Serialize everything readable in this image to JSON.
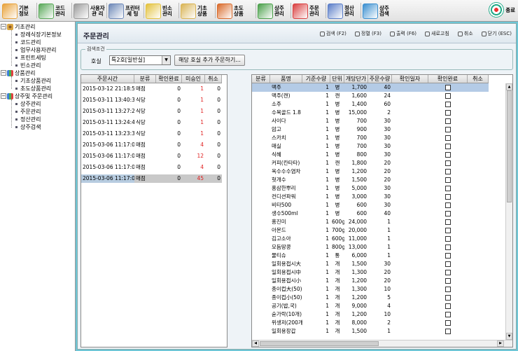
{
  "toolbar": {
    "items": [
      {
        "label": "기본\n정보",
        "icon": "pencils-icon",
        "color": "#e8a23a"
      },
      {
        "label": "코드\n관리",
        "icon": "colorful-grid-icon",
        "color": "#58a858"
      },
      {
        "label": "사용자\n관 리",
        "icon": "user-robot-icon",
        "color": "#9a9a9a"
      },
      {
        "label": "프린터\n세 팅",
        "icon": "printer-icon",
        "color": "#6d88b8"
      },
      {
        "label": "빈소\n관리",
        "icon": "folder-icon",
        "color": "#e3c23d"
      },
      {
        "label": "기초\n상품",
        "icon": "cube-icon",
        "color": "#d9b455"
      },
      {
        "label": "초도\n상품",
        "icon": "books-icon",
        "color": "#d96a2a"
      },
      {
        "label": "상주\n관리",
        "icon": "people-group-icon",
        "color": "#4aa04a"
      },
      {
        "label": "주문\n관리",
        "icon": "order-form-icon",
        "color": "#d94040"
      },
      {
        "label": "정산\n관리",
        "icon": "calculator-icon",
        "color": "#5a7dc8"
      },
      {
        "label": "상주\n검색",
        "icon": "magnifier-icon",
        "color": "#3a8fd0"
      }
    ],
    "exit_label": "종료",
    "exit_icon": "target-icon"
  },
  "tree": {
    "groups": [
      {
        "label": "기초관리",
        "icon": "gear-folder-icon",
        "expand": "⊟",
        "children": [
          "장례식장기본정보",
          "코드관리",
          "업무사용자관리",
          "프린트세팅",
          "빈소관리"
        ]
      },
      {
        "label": "상품관리",
        "icon": "bar-chart-icon",
        "expand": "⊟",
        "children": [
          "기초상품관리",
          "초도상품관리"
        ]
      },
      {
        "label": "상주및 주문관리",
        "icon": "bar-chart-icon",
        "expand": "⊟",
        "children": [
          "상주관리",
          "주문관리",
          "정산관리",
          "상주검색"
        ]
      }
    ]
  },
  "panel": {
    "title": "주문관리",
    "actions": [
      "검색 (F2)",
      "정렬 (F3)",
      "출력 (F6)",
      "새로고침",
      "취소",
      "닫기 (ESC)"
    ],
    "search_legend": "검색조건",
    "room_label": "호실",
    "room_value": "특2호[일반실]",
    "add_button": "해당 호실 추가 주문하기..."
  },
  "left_grid": {
    "columns": [
      "주문시간",
      "분류",
      "확인완료",
      "미승인",
      "취소"
    ],
    "rows": [
      [
        "2015-03-12 21:18:52",
        "매점",
        "0",
        "1",
        "0"
      ],
      [
        "2015-03-11 13:40:36",
        "식당",
        "0",
        "1",
        "0"
      ],
      [
        "2015-03-11 13:27:26",
        "식당",
        "0",
        "1",
        "0"
      ],
      [
        "2015-03-11 13:24:42",
        "식당",
        "0",
        "1",
        "0"
      ],
      [
        "2015-03-11 13:23:37",
        "식당",
        "0",
        "1",
        "0"
      ],
      [
        "2015-03-06 11:17:08",
        "매점",
        "0",
        "4",
        "0"
      ],
      [
        "2015-03-06 11:17:08",
        "매점",
        "0",
        "12",
        "0"
      ],
      [
        "2015-03-06 11:17:08",
        "매점",
        "0",
        "4",
        "0"
      ],
      [
        "2015-03-06 11:17:08",
        "매점",
        "0",
        "45",
        "0"
      ]
    ],
    "selected_index": 8
  },
  "right_grid": {
    "columns": [
      "분류",
      "품명",
      "기준수량",
      "단위",
      "개당단가",
      "주문수량",
      "확인일자",
      "확인완료",
      "취소"
    ],
    "rows": [
      [
        "",
        "맥주",
        "1",
        "병",
        "1,700",
        "40",
        "",
        "",
        ""
      ],
      [
        "",
        "맥주(캔)",
        "1",
        "캔",
        "1,600",
        "24",
        "",
        "",
        ""
      ],
      [
        "",
        "소주",
        "1",
        "병",
        "1,400",
        "60",
        "",
        "",
        ""
      ],
      [
        "",
        "수복골드 1.8",
        "1",
        "병",
        "15,000",
        "2",
        "",
        "",
        ""
      ],
      [
        "",
        "사이다",
        "1",
        "병",
        "700",
        "30",
        "",
        "",
        ""
      ],
      [
        "",
        "암고",
        "1",
        "병",
        "900",
        "30",
        "",
        "",
        ""
      ],
      [
        "",
        "스카치",
        "1",
        "병",
        "700",
        "30",
        "",
        "",
        ""
      ],
      [
        "",
        "매실",
        "1",
        "병",
        "700",
        "30",
        "",
        "",
        ""
      ],
      [
        "",
        "식혜",
        "1",
        "병",
        "800",
        "30",
        "",
        "",
        ""
      ],
      [
        "",
        "커피(칸타타)",
        "1",
        "캔",
        "1,800",
        "20",
        "",
        "",
        ""
      ],
      [
        "",
        "옥수수수염차",
        "1",
        "병",
        "1,200",
        "20",
        "",
        "",
        ""
      ],
      [
        "",
        "헛개수",
        "1",
        "병",
        "1,500",
        "20",
        "",
        "",
        ""
      ],
      [
        "",
        "홍삼한뿌리",
        "1",
        "병",
        "5,000",
        "30",
        "",
        "",
        ""
      ],
      [
        "",
        "컨디션파워",
        "1",
        "병",
        "3,000",
        "30",
        "",
        "",
        ""
      ],
      [
        "",
        "비타500",
        "1",
        "병",
        "600",
        "30",
        "",
        "",
        ""
      ],
      [
        "",
        "생수500ml",
        "1",
        "병",
        "600",
        "40",
        "",
        "",
        ""
      ],
      [
        "",
        "홍진미",
        "1",
        "600g",
        "24,000",
        "1",
        "",
        "",
        ""
      ],
      [
        "",
        "아몬드",
        "1",
        "700g",
        "20,000",
        "1",
        "",
        "",
        ""
      ],
      [
        "",
        "김고소아",
        "1",
        "600g",
        "11,000",
        "1",
        "",
        "",
        ""
      ],
      [
        "",
        "모듬땅콩",
        "1",
        "800g",
        "13,000",
        "1",
        "",
        "",
        ""
      ],
      [
        "",
        "물티슈",
        "1",
        "통",
        "6,000",
        "1",
        "",
        "",
        ""
      ],
      [
        "",
        "일회용접시大",
        "1",
        "개",
        "1,500",
        "30",
        "",
        "",
        ""
      ],
      [
        "",
        "일회용접시中",
        "1",
        "개",
        "1,300",
        "20",
        "",
        "",
        ""
      ],
      [
        "",
        "일회용접시小",
        "1",
        "개",
        "1,200",
        "20",
        "",
        "",
        ""
      ],
      [
        "",
        "종이컵大(50)",
        "1",
        "개",
        "1,300",
        "10",
        "",
        "",
        ""
      ],
      [
        "",
        "종이컵小(50)",
        "1",
        "개",
        "1,200",
        "5",
        "",
        "",
        ""
      ],
      [
        "",
        "공기(밥,국)",
        "1",
        "개",
        "9,000",
        "4",
        "",
        "",
        ""
      ],
      [
        "",
        "숟가락(10개)",
        "1",
        "개",
        "1,200",
        "10",
        "",
        "",
        ""
      ],
      [
        "",
        "위생저(200개)",
        "1",
        "개",
        "8,000",
        "2",
        "",
        "",
        ""
      ],
      [
        "",
        "일회용장갑",
        "1",
        "개",
        "1,500",
        "1",
        "",
        "",
        ""
      ]
    ],
    "selected_index": 0,
    "checkbox_rows": 30
  }
}
